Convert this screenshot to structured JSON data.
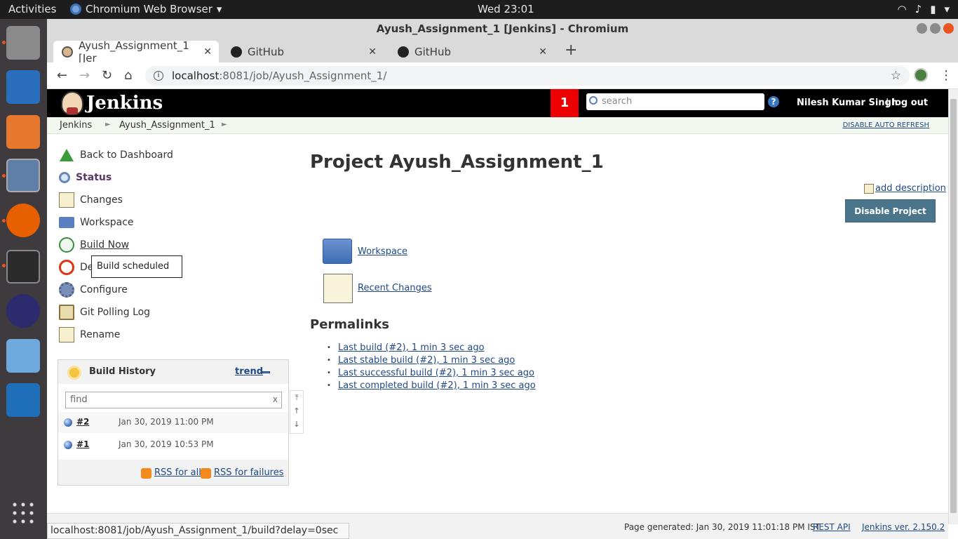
{
  "topbar": {
    "activities": "Activities",
    "app_name": "Chromium Web Browser",
    "clock": "Wed 23:01"
  },
  "window": {
    "title": "Ayush_Assignment_1 [Jenkins] - Chromium"
  },
  "tabs": [
    {
      "label": "Ayush_Assignment_1 [Jer",
      "active": true
    },
    {
      "label": "GitHub",
      "active": false
    },
    {
      "label": "GitHub",
      "active": false
    }
  ],
  "omnibox": {
    "host": "localhost",
    "path": ":8081/job/Ayush_Assignment_1/"
  },
  "jenkins_header": {
    "title": "Jenkins",
    "notification_count": "1",
    "search_placeholder": "search",
    "user": "Nilesh Kumar Singh",
    "logout_prefix": "|",
    "logout": "log out"
  },
  "breadcrumb": {
    "items": [
      "Jenkins",
      "Ayush_Assignment_1"
    ],
    "auto_refresh": "DISABLE AUTO REFRESH"
  },
  "side_tasks": [
    {
      "label": "Back to Dashboard",
      "icon": "up-arrow-icon"
    },
    {
      "label": "Status",
      "icon": "magnifier-icon"
    },
    {
      "label": "Changes",
      "icon": "notepad-icon"
    },
    {
      "label": "Workspace",
      "icon": "folder-icon"
    },
    {
      "label": "Build Now",
      "icon": "clock-icon"
    },
    {
      "label": "De",
      "icon": "no-entry-icon"
    },
    {
      "label": "Configure",
      "icon": "gear-icon"
    },
    {
      "label": "Git Polling Log",
      "icon": "clipboard-icon"
    },
    {
      "label": "Rename",
      "icon": "notepad-icon"
    }
  ],
  "tooltip": "Build scheduled",
  "build_history": {
    "title": "Build History",
    "trend": "trend",
    "find_placeholder": "find",
    "find_clear": "x",
    "builds": [
      {
        "number": "#2",
        "date": "Jan 30, 2019 11:00 PM"
      },
      {
        "number": "#1",
        "date": "Jan 30, 2019 10:53 PM"
      }
    ],
    "rss_all": "RSS for all",
    "rss_failures": "RSS for failures"
  },
  "main": {
    "title": "Project Ayush_Assignment_1",
    "add_description": "add description",
    "disable_button": "Disable Project",
    "workspace_link": "Workspace",
    "recent_changes_link": "Recent Changes",
    "permalinks_heading": "Permalinks",
    "permalinks": [
      "Last build (#2), 1 min 3 sec ago",
      "Last stable build (#2), 1 min 3 sec ago",
      "Last successful build (#2), 1 min 3 sec ago",
      "Last completed build (#2), 1 min 3 sec ago"
    ]
  },
  "footer": {
    "page_generated": "Page generated: Jan 30, 2019 11:01:18 PM IST",
    "rest_api": "REST API",
    "version": "Jenkins ver. 2.150.2"
  },
  "status_url": "localhost:8081/job/Ayush_Assignment_1/build?delay=0sec",
  "colors": {
    "jenkins_header_bg": "#000000",
    "notification_badge": "#ee0000",
    "link": "#204a87",
    "disable_button_bg": "#4b758b",
    "ubuntu_dock_bg": "#3e3a3e"
  }
}
